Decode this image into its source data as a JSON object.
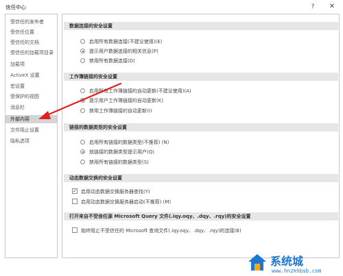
{
  "window": {
    "title": "信任中心",
    "help": "?",
    "close": "✕"
  },
  "sidebar": {
    "items": [
      {
        "label": "受信任的发布者"
      },
      {
        "label": "受信任位置"
      },
      {
        "label": "受信任的文档"
      },
      {
        "label": "受信任的加载项目录"
      },
      {
        "label": "加载项"
      },
      {
        "label": "ActiveX 设置"
      },
      {
        "label": "宏设置"
      },
      {
        "label": "受保护的视图"
      },
      {
        "label": "消息栏"
      },
      {
        "label": "外部内容",
        "selected": true
      },
      {
        "label": "文件阻止设置"
      },
      {
        "label": "隐私选项"
      }
    ]
  },
  "sections": {
    "data_connections": {
      "header": "数据连接的安全设置",
      "options": [
        {
          "label": "启用所有数据连接(不建议使用)(E)",
          "checked": false
        },
        {
          "label": "提示用户数据连接的相关信息(P)",
          "checked": true
        },
        {
          "label": "禁用所有数据连接(D)",
          "checked": false
        }
      ]
    },
    "workbook_links": {
      "header": "工作簿链接的安全设置",
      "options": [
        {
          "label": "启用所有工作簿链接的自动更新(不建议使用)(A)",
          "checked": false
        },
        {
          "label": "提示用户工作簿链接的自动更新(K)",
          "checked": true
        },
        {
          "label": "禁用工作簿链接的自动更新(I)",
          "checked": false
        }
      ]
    },
    "linked_types": {
      "header": "链接的数据类型的安全设置",
      "options": [
        {
          "label": "启用所有链接的数据类型(不推荐) (N)",
          "checked": false
        },
        {
          "label": "就链接的数据类型提示用户(Q)",
          "checked": true
        },
        {
          "label": "禁用所有链接的数据类型(S)",
          "checked": false
        }
      ]
    },
    "dde": {
      "header": "动态数据交换的安全设置",
      "options": [
        {
          "label": "启用动态数据交换服务器查找(Y)",
          "checked": true
        },
        {
          "label": "启用动态数据交换服务器启动(不推荐) (M)",
          "checked": false
        }
      ]
    },
    "query_files": {
      "header": "打开来自不受信任源 Microsoft Query 文件(.iqy.oqy、.dqy、.rqy)的安全设置",
      "options": [
        {
          "label": "始终阻止不受信任的 Microsoft 查询文件(.iqy.oqy、.dqy、.rqy)的连接(B)",
          "checked": false
        }
      ]
    }
  },
  "annotation": {
    "color": "#e02020"
  },
  "watermark": {
    "title": "系统城",
    "site": "www.hnzkhbsb.com"
  }
}
